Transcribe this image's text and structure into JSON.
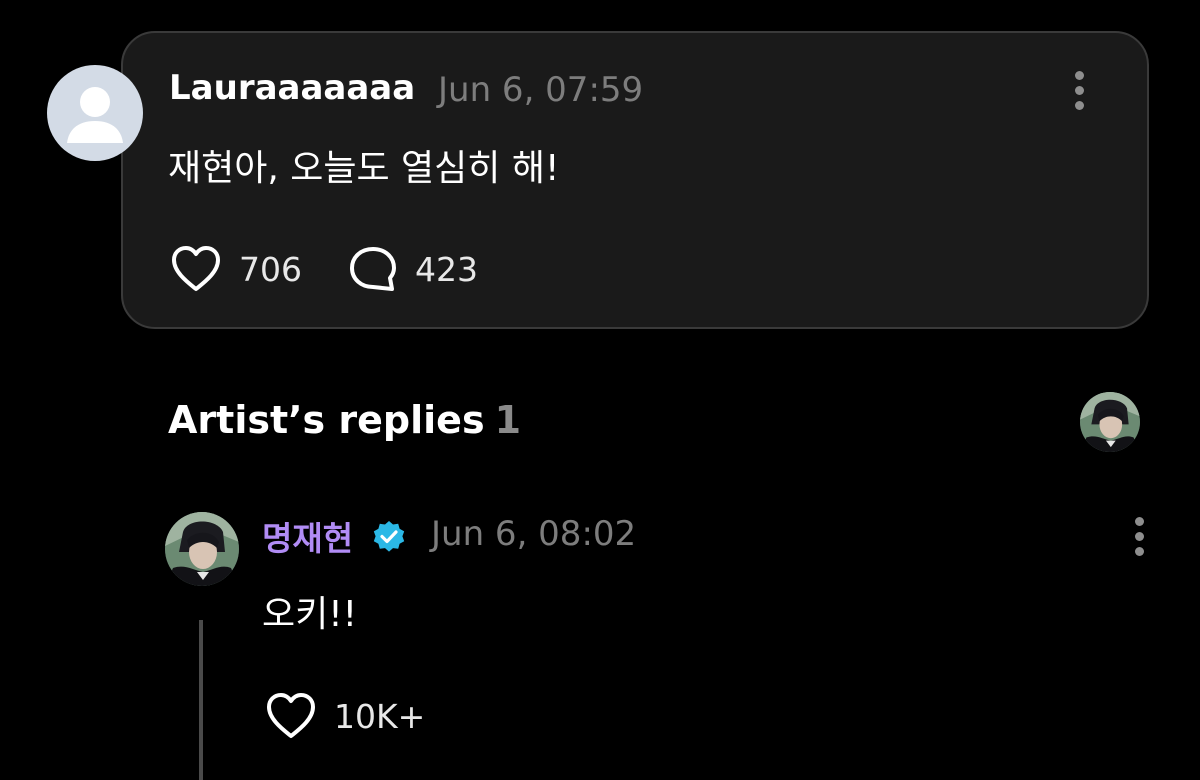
{
  "comment": {
    "author": "Lauraaaaaaa",
    "timestamp": "Jun 6, 07:59",
    "text": "재현아, 오늘도 열심히 해!",
    "likes": "706",
    "replies": "423"
  },
  "artist_replies": {
    "title": "Artist’s replies",
    "count": "1"
  },
  "reply": {
    "author": "명재현",
    "verified": true,
    "timestamp": "Jun 6, 08:02",
    "text": "오키!!",
    "likes": "10K+"
  },
  "colors": {
    "background": "#000000",
    "card": "#1a1a1a",
    "artist_name": "#b18cf5",
    "verified_badge": "#2bb8e6",
    "muted_text": "#7d7d7d"
  },
  "icons": [
    "more-options-icon",
    "heart-icon",
    "comment-bubble-icon",
    "verified-badge-icon",
    "user-silhouette-icon"
  ]
}
